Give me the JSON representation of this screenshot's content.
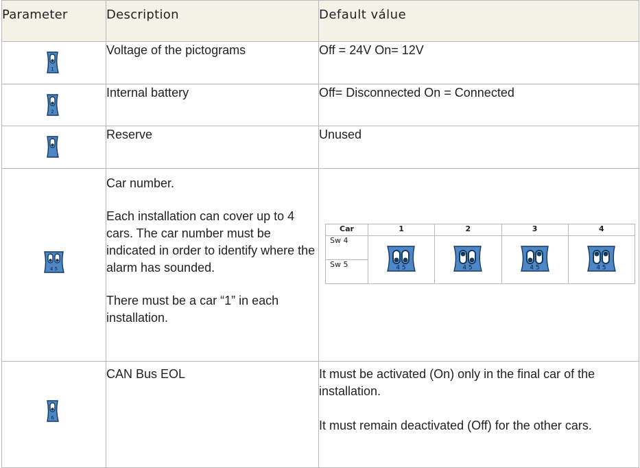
{
  "table": {
    "headers": {
      "parameter": "Parameter",
      "description": "Description",
      "default_value": "Default válue"
    },
    "rows": [
      {
        "switch_label": "1",
        "description": "Voltage of the pictograms",
        "default": "Off = 24V On= 12V"
      },
      {
        "switch_label": "2",
        "description": "Internal battery",
        "default": "Off= Disconnected On = Connected"
      },
      {
        "switch_label": "",
        "description": "Reserve",
        "default": "Unused"
      },
      {
        "switch_label": "4 5",
        "description_lines": [
          "Car number.",
          "Each installation can cover up to 4 cars. The car number must be indicated in order to identify where the alarm has sounded.",
          "There must be a car “1” in each installation."
        ]
      },
      {
        "switch_label": "6",
        "description": "CAN Bus EOL",
        "default_lines": [
          "It must be activated (On) only in the final car  of the installation.",
          "It must remain deactivated (Off) for the other cars."
        ]
      }
    ]
  },
  "car_table": {
    "header": "Car",
    "cars": [
      "1",
      "2",
      "3",
      "4"
    ],
    "row_labels": [
      "Sw 4",
      "Sw 5"
    ],
    "switch_label": "4 5"
  },
  "colors": {
    "switch_fill": "#4f86c6",
    "switch_stroke": "#123a63",
    "header_bg": "#f4f1e6"
  }
}
